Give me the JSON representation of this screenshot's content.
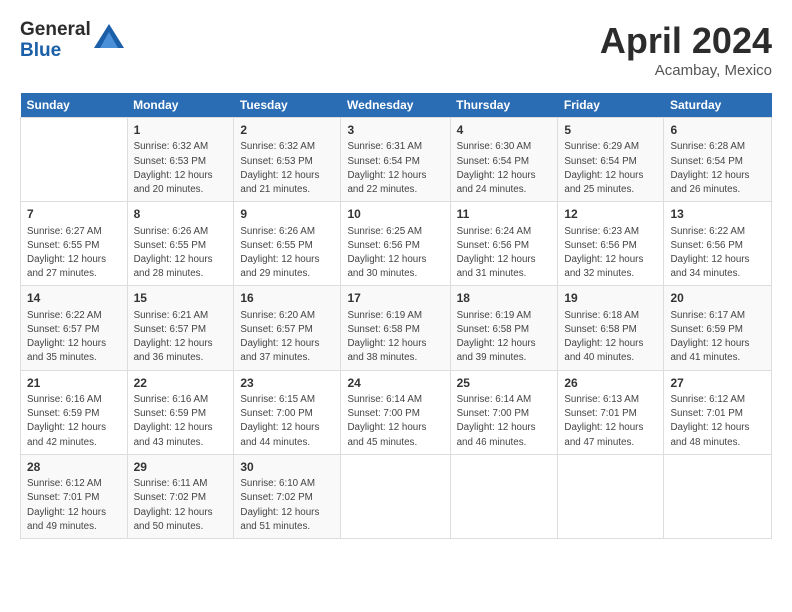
{
  "logo": {
    "line1": "General",
    "line2": "Blue"
  },
  "title": "April 2024",
  "location": "Acambay, Mexico",
  "days_header": [
    "Sunday",
    "Monday",
    "Tuesday",
    "Wednesday",
    "Thursday",
    "Friday",
    "Saturday"
  ],
  "weeks": [
    [
      {
        "num": "",
        "info": ""
      },
      {
        "num": "1",
        "info": "Sunrise: 6:32 AM\nSunset: 6:53 PM\nDaylight: 12 hours\nand 20 minutes."
      },
      {
        "num": "2",
        "info": "Sunrise: 6:32 AM\nSunset: 6:53 PM\nDaylight: 12 hours\nand 21 minutes."
      },
      {
        "num": "3",
        "info": "Sunrise: 6:31 AM\nSunset: 6:54 PM\nDaylight: 12 hours\nand 22 minutes."
      },
      {
        "num": "4",
        "info": "Sunrise: 6:30 AM\nSunset: 6:54 PM\nDaylight: 12 hours\nand 24 minutes."
      },
      {
        "num": "5",
        "info": "Sunrise: 6:29 AM\nSunset: 6:54 PM\nDaylight: 12 hours\nand 25 minutes."
      },
      {
        "num": "6",
        "info": "Sunrise: 6:28 AM\nSunset: 6:54 PM\nDaylight: 12 hours\nand 26 minutes."
      }
    ],
    [
      {
        "num": "7",
        "info": "Sunrise: 6:27 AM\nSunset: 6:55 PM\nDaylight: 12 hours\nand 27 minutes."
      },
      {
        "num": "8",
        "info": "Sunrise: 6:26 AM\nSunset: 6:55 PM\nDaylight: 12 hours\nand 28 minutes."
      },
      {
        "num": "9",
        "info": "Sunrise: 6:26 AM\nSunset: 6:55 PM\nDaylight: 12 hours\nand 29 minutes."
      },
      {
        "num": "10",
        "info": "Sunrise: 6:25 AM\nSunset: 6:56 PM\nDaylight: 12 hours\nand 30 minutes."
      },
      {
        "num": "11",
        "info": "Sunrise: 6:24 AM\nSunset: 6:56 PM\nDaylight: 12 hours\nand 31 minutes."
      },
      {
        "num": "12",
        "info": "Sunrise: 6:23 AM\nSunset: 6:56 PM\nDaylight: 12 hours\nand 32 minutes."
      },
      {
        "num": "13",
        "info": "Sunrise: 6:22 AM\nSunset: 6:56 PM\nDaylight: 12 hours\nand 34 minutes."
      }
    ],
    [
      {
        "num": "14",
        "info": "Sunrise: 6:22 AM\nSunset: 6:57 PM\nDaylight: 12 hours\nand 35 minutes."
      },
      {
        "num": "15",
        "info": "Sunrise: 6:21 AM\nSunset: 6:57 PM\nDaylight: 12 hours\nand 36 minutes."
      },
      {
        "num": "16",
        "info": "Sunrise: 6:20 AM\nSunset: 6:57 PM\nDaylight: 12 hours\nand 37 minutes."
      },
      {
        "num": "17",
        "info": "Sunrise: 6:19 AM\nSunset: 6:58 PM\nDaylight: 12 hours\nand 38 minutes."
      },
      {
        "num": "18",
        "info": "Sunrise: 6:19 AM\nSunset: 6:58 PM\nDaylight: 12 hours\nand 39 minutes."
      },
      {
        "num": "19",
        "info": "Sunrise: 6:18 AM\nSunset: 6:58 PM\nDaylight: 12 hours\nand 40 minutes."
      },
      {
        "num": "20",
        "info": "Sunrise: 6:17 AM\nSunset: 6:59 PM\nDaylight: 12 hours\nand 41 minutes."
      }
    ],
    [
      {
        "num": "21",
        "info": "Sunrise: 6:16 AM\nSunset: 6:59 PM\nDaylight: 12 hours\nand 42 minutes."
      },
      {
        "num": "22",
        "info": "Sunrise: 6:16 AM\nSunset: 6:59 PM\nDaylight: 12 hours\nand 43 minutes."
      },
      {
        "num": "23",
        "info": "Sunrise: 6:15 AM\nSunset: 7:00 PM\nDaylight: 12 hours\nand 44 minutes."
      },
      {
        "num": "24",
        "info": "Sunrise: 6:14 AM\nSunset: 7:00 PM\nDaylight: 12 hours\nand 45 minutes."
      },
      {
        "num": "25",
        "info": "Sunrise: 6:14 AM\nSunset: 7:00 PM\nDaylight: 12 hours\nand 46 minutes."
      },
      {
        "num": "26",
        "info": "Sunrise: 6:13 AM\nSunset: 7:01 PM\nDaylight: 12 hours\nand 47 minutes."
      },
      {
        "num": "27",
        "info": "Sunrise: 6:12 AM\nSunset: 7:01 PM\nDaylight: 12 hours\nand 48 minutes."
      }
    ],
    [
      {
        "num": "28",
        "info": "Sunrise: 6:12 AM\nSunset: 7:01 PM\nDaylight: 12 hours\nand 49 minutes."
      },
      {
        "num": "29",
        "info": "Sunrise: 6:11 AM\nSunset: 7:02 PM\nDaylight: 12 hours\nand 50 minutes."
      },
      {
        "num": "30",
        "info": "Sunrise: 6:10 AM\nSunset: 7:02 PM\nDaylight: 12 hours\nand 51 minutes."
      },
      {
        "num": "",
        "info": ""
      },
      {
        "num": "",
        "info": ""
      },
      {
        "num": "",
        "info": ""
      },
      {
        "num": "",
        "info": ""
      }
    ]
  ]
}
